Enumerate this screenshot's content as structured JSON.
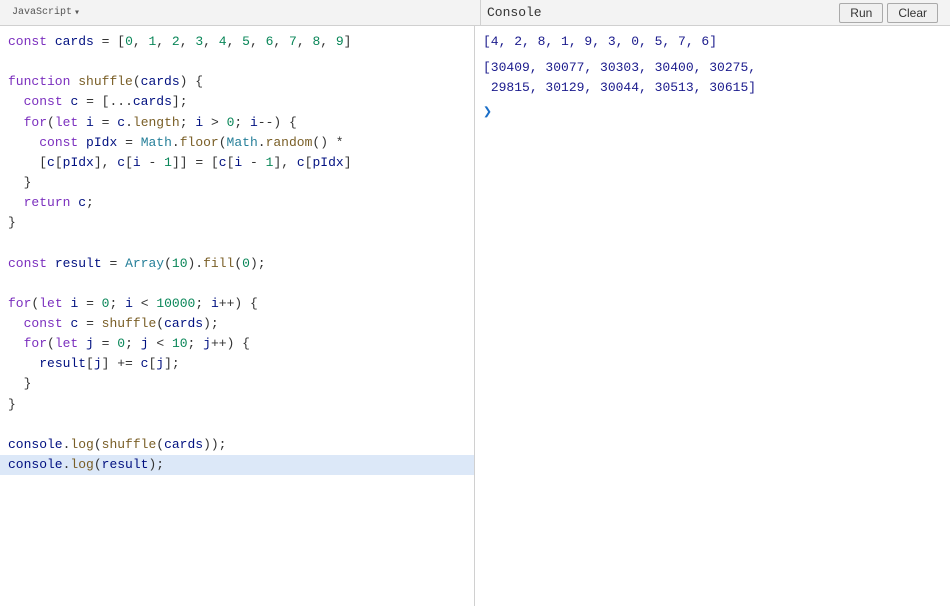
{
  "topbar": {
    "lang_label": "JavaScript",
    "lang_dropdown_icon": "▾",
    "console_label": "Console",
    "run_button": "Run",
    "clear_button": "Clear"
  },
  "editor": {
    "lines": [
      {
        "text": "const cards = [0, 1, 2, 3, 4, 5, 6, 7, 8, 9]",
        "highlighted": false
      },
      {
        "text": "",
        "highlighted": false
      },
      {
        "text": "function shuffle(cards) {",
        "highlighted": false
      },
      {
        "text": "  const c = [...cards];",
        "highlighted": false
      },
      {
        "text": "  for(let i = c.length; i > 0; i--) {",
        "highlighted": false
      },
      {
        "text": "    const pIdx = Math.floor(Math.random() *",
        "highlighted": false
      },
      {
        "text": "    [c[pIdx], c[i - 1]] = [c[i - 1], c[pIdx]",
        "highlighted": false
      },
      {
        "text": "  }",
        "highlighted": false
      },
      {
        "text": "  return c;",
        "highlighted": false
      },
      {
        "text": "}",
        "highlighted": false
      },
      {
        "text": "",
        "highlighted": false
      },
      {
        "text": "const result = Array(10).fill(0);",
        "highlighted": false
      },
      {
        "text": "",
        "highlighted": false
      },
      {
        "text": "for(let i = 0; i < 10000; i++) {",
        "highlighted": false
      },
      {
        "text": "  const c = shuffle(cards);",
        "highlighted": false
      },
      {
        "text": "  for(let j = 0; j < 10; j++) {",
        "highlighted": false
      },
      {
        "text": "    result[j] += c[j];",
        "highlighted": false
      },
      {
        "text": "  }",
        "highlighted": false
      },
      {
        "text": "}",
        "highlighted": false
      },
      {
        "text": "",
        "highlighted": false
      },
      {
        "text": "console.log(shuffle(cards));",
        "highlighted": false
      },
      {
        "text": "console.log(result);",
        "highlighted": true
      }
    ]
  },
  "console": {
    "output1": "[4, 2, 8, 1, 9, 3, 0, 5, 7, 6]",
    "output2": "[30409, 30077, 30303, 30400, 30275,\n 29815, 30129, 30044, 30513, 30615]",
    "prompt_arrow": "❯"
  }
}
